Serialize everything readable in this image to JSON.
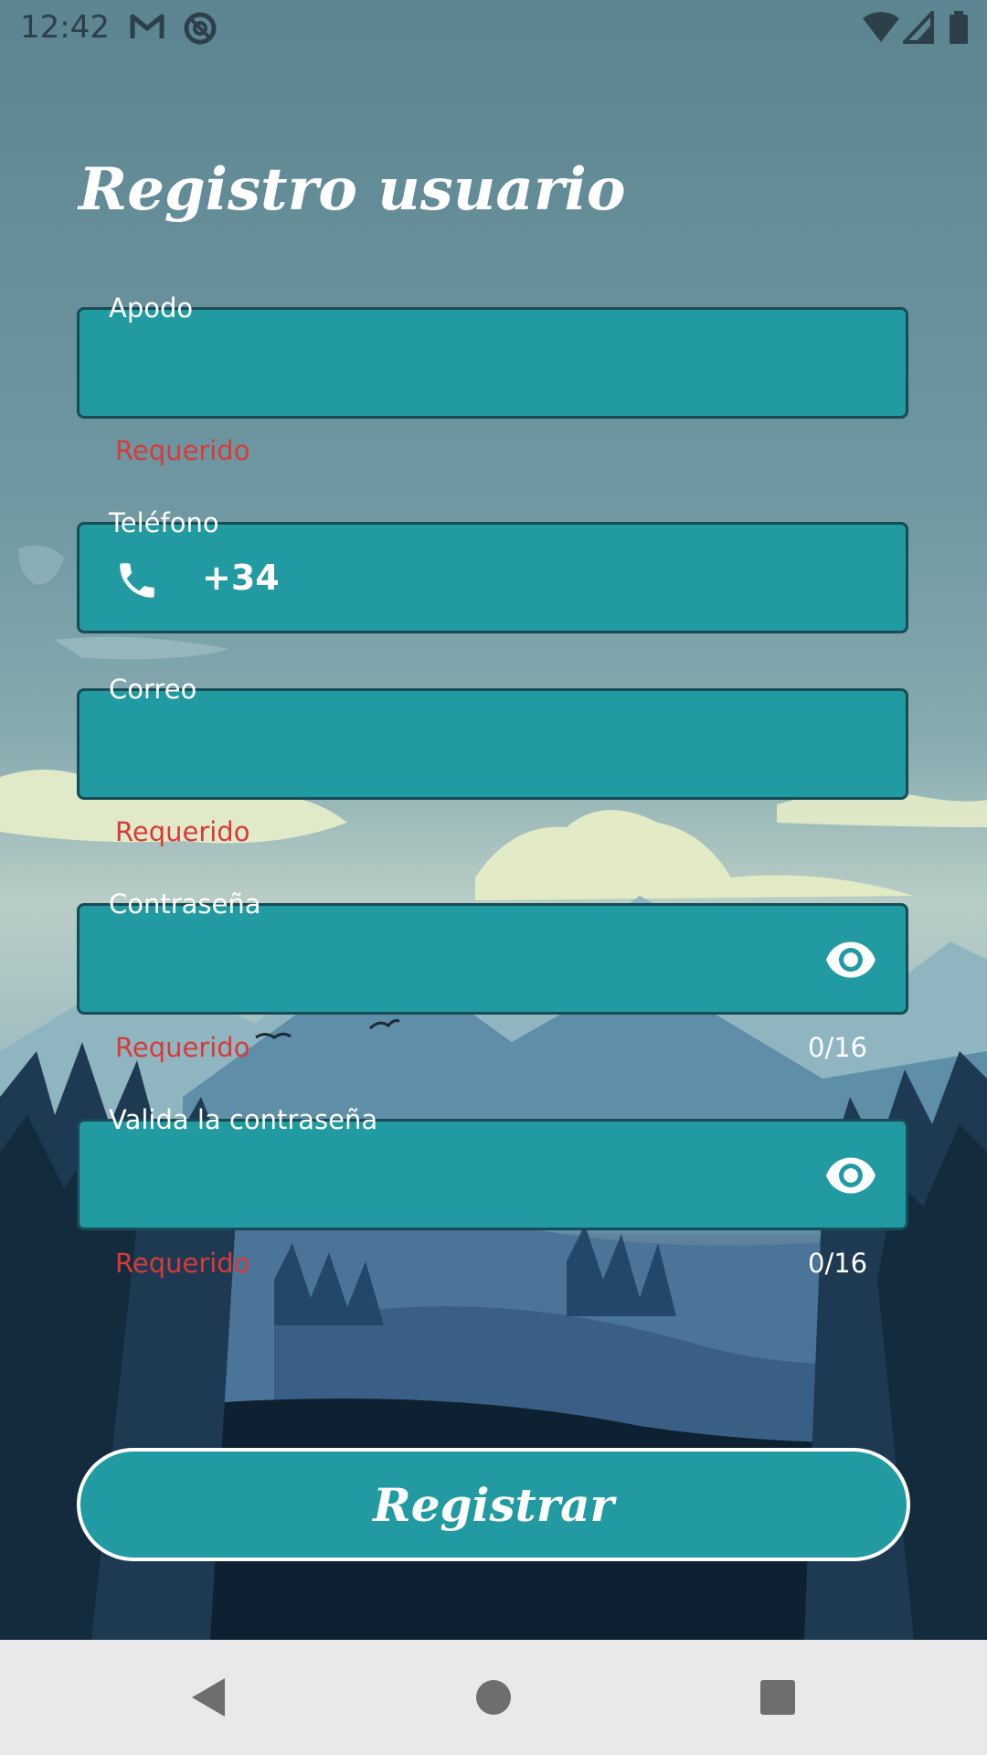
{
  "status_bar": {
    "time": "12:42",
    "icons": [
      "gmail-icon",
      "at-sign-icon",
      "wifi-icon",
      "signal-icon",
      "battery-icon"
    ]
  },
  "title": "Registro usuario",
  "fields": {
    "apodo": {
      "label": "Apodo",
      "value": "",
      "helper": "Requerido"
    },
    "telefono": {
      "label": "Teléfono",
      "prefix": "+34",
      "value": "",
      "icon": "phone-icon"
    },
    "correo": {
      "label": "Correo",
      "value": "",
      "helper": "Requerido"
    },
    "contrasena": {
      "label": "Contraseña",
      "value": "",
      "helper": "Requerido",
      "counter": "0/16",
      "icon": "eye-icon"
    },
    "valida": {
      "label": "Valida la contraseña",
      "value": "",
      "helper": "Requerido",
      "counter": "0/16",
      "icon": "eye-icon"
    }
  },
  "button": {
    "label": "Registrar"
  },
  "nav_bar": {
    "icons": [
      "back-icon",
      "home-icon",
      "recents-icon"
    ]
  },
  "colors": {
    "field_bg": "#219aa2",
    "field_border": "#174c57",
    "error": "#d83a3a",
    "text": "#ffffff",
    "nav_bg": "#e9e9eb"
  }
}
